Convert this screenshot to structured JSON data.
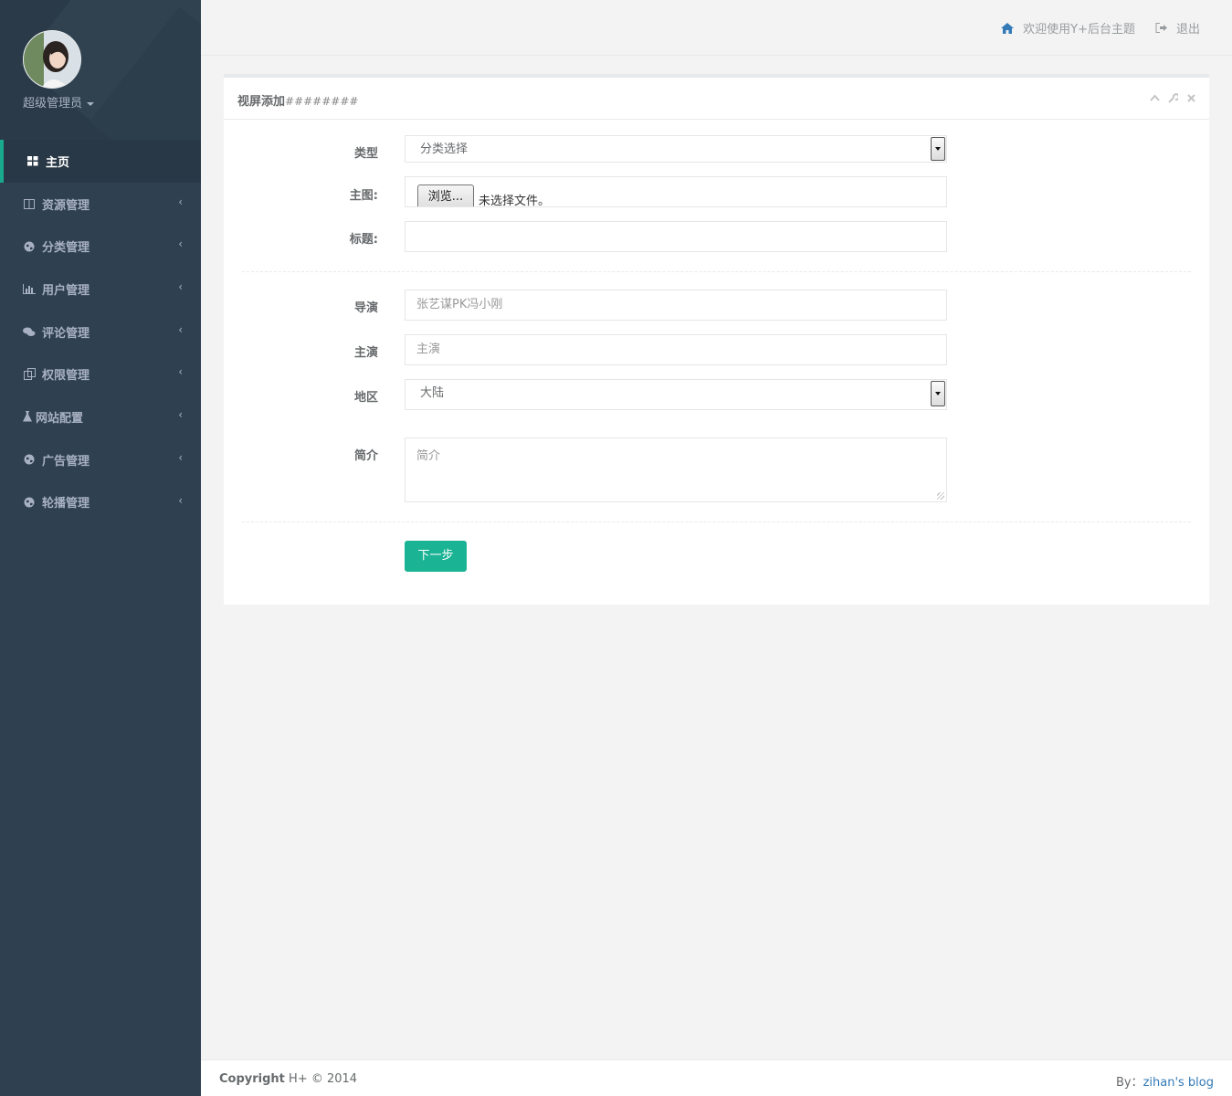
{
  "sidebar": {
    "user_name": "超级管理员",
    "items": [
      {
        "label": "主页",
        "icon": "grid-icon",
        "active": true
      },
      {
        "label": "资源管理",
        "icon": "columns-icon"
      },
      {
        "label": "分类管理",
        "icon": "globe-icon"
      },
      {
        "label": "用户管理",
        "icon": "bar-chart-icon"
      },
      {
        "label": "评论管理",
        "icon": "comments-icon"
      },
      {
        "label": "权限管理",
        "icon": "copy-icon"
      },
      {
        "label": "网站配置",
        "icon": "flask-icon"
      },
      {
        "label": "广告管理",
        "icon": "globe-icon"
      },
      {
        "label": "轮播管理",
        "icon": "globe-icon"
      }
    ]
  },
  "topbar": {
    "welcome": "欢迎使用Y+后台主题",
    "logout": "退出"
  },
  "panel": {
    "title": "视屏添加",
    "title_suffix": "########"
  },
  "form": {
    "type_label": "类型",
    "type_value": "分类选择",
    "image_label": "主图:",
    "browse_label": "浏览...",
    "no_file_text": "未选择文件。",
    "title_label": "标题:",
    "title_value": "",
    "director_label": "导演",
    "director_placeholder": "张艺谋PK冯小刚",
    "actor_label": "主演",
    "actor_placeholder": "主演",
    "region_label": "地区",
    "region_value": "大陆",
    "intro_label": "简介",
    "intro_placeholder": "简介",
    "next_button": "下一步"
  },
  "footer": {
    "copyright_bold": "Copyright",
    "copyright_rest": " H+ © 2014",
    "by_label": "By：",
    "blog_link": "zihan's blog"
  },
  "colors": {
    "sidebar_bg": "#2f4050",
    "accent": "#1ab394",
    "link": "#337ab7"
  }
}
